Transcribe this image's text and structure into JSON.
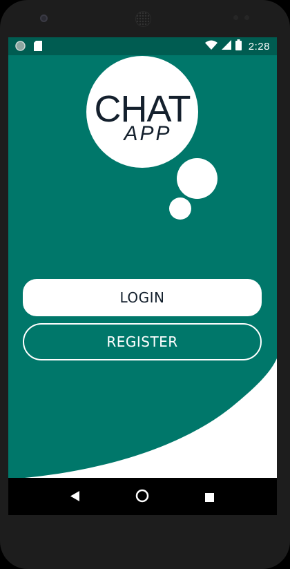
{
  "status_bar": {
    "time": "2:28",
    "icons": [
      "circle-status-icon",
      "sd-card-icon",
      "wifi-icon",
      "cell-signal-icon",
      "battery-icon"
    ]
  },
  "logo": {
    "line1": "CHAT",
    "line2": "APP"
  },
  "buttons": {
    "login_label": "LOGIN",
    "register_label": "REGISTER"
  },
  "nav": {
    "icons": [
      "back-triangle-icon",
      "home-circle-icon",
      "recents-square-icon"
    ]
  },
  "colors": {
    "primary": "#00776a",
    "status_bar": "#005c51",
    "logo_text": "#14202d",
    "white": "#ffffff"
  }
}
